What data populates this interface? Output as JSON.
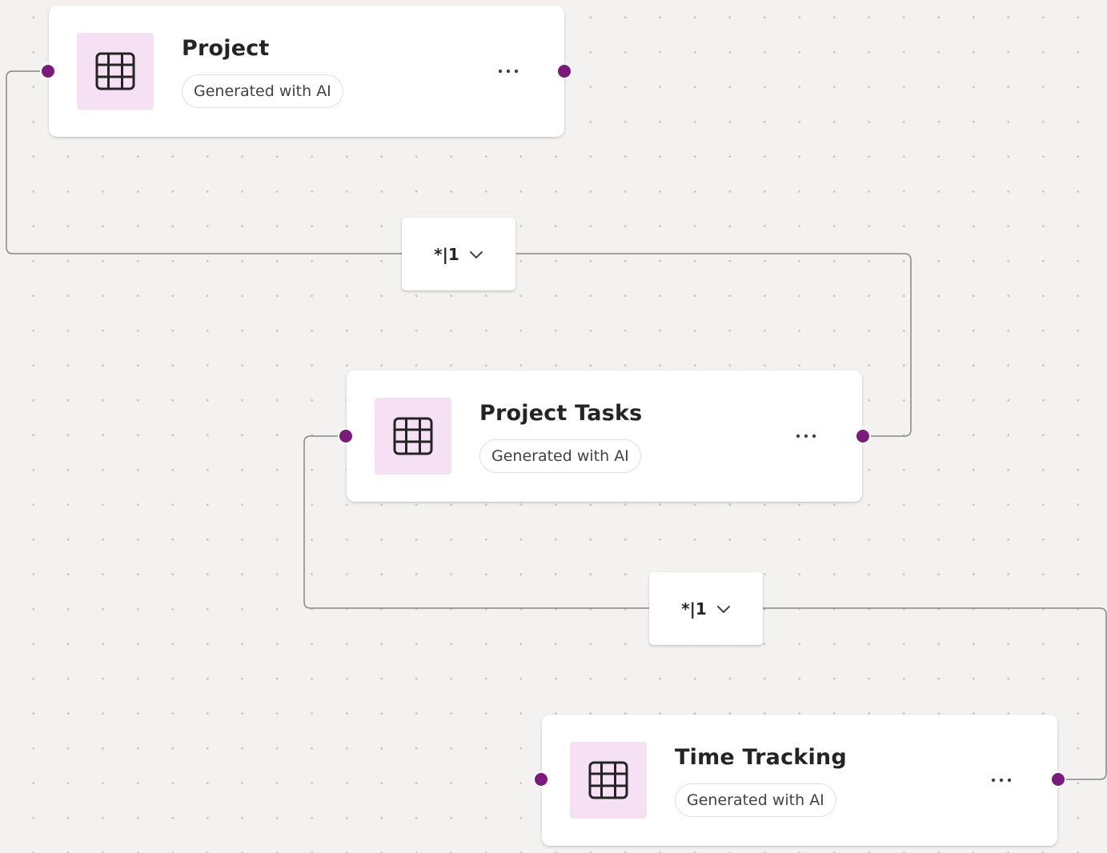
{
  "canvas": {
    "background": "#f3f2f1",
    "accent_color": "#7a1a7a",
    "icon_tile_color": "#f5e1f3",
    "connector_color": "#8a8886"
  },
  "tables": [
    {
      "name": "Project",
      "badge": "Generated with AI",
      "icon": "table-grid-icon",
      "more_label": "..."
    },
    {
      "name": "Project Tasks",
      "badge": "Generated with AI",
      "icon": "table-grid-icon",
      "more_label": "..."
    },
    {
      "name": "Time Tracking",
      "badge": "Generated with AI",
      "icon": "table-grid-icon",
      "more_label": "..."
    }
  ],
  "relationships": [
    {
      "label": "*|1",
      "icon": "chevron-down-icon"
    },
    {
      "label": "*|1",
      "icon": "chevron-down-icon"
    }
  ]
}
